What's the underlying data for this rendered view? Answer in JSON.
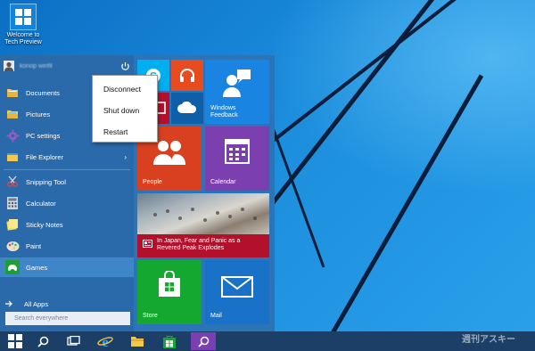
{
  "desktop": {
    "icon_label": "Welcome to Tech Preview",
    "watermark": "週刊アスキー"
  },
  "start_menu": {
    "user_name": "konop winfil",
    "left_items": [
      {
        "label": "Documents",
        "icon": "documents-folder-icon"
      },
      {
        "label": "Pictures",
        "icon": "pictures-folder-icon"
      },
      {
        "label": "PC settings",
        "icon": "gear-icon"
      },
      {
        "label": "File Explorer",
        "icon": "file-explorer-icon",
        "arrow": "›"
      },
      {
        "label": "Snipping Tool",
        "icon": "scissors-icon"
      },
      {
        "label": "Calculator",
        "icon": "calculator-icon"
      },
      {
        "label": "Sticky Notes",
        "icon": "sticky-notes-icon"
      },
      {
        "label": "Paint",
        "icon": "paint-palette-icon"
      },
      {
        "label": "Games",
        "icon": "xbox-games-icon"
      }
    ],
    "all_apps": "All Apps",
    "search_placeholder": "Search everywhere"
  },
  "power_menu": {
    "items": [
      "Disconnect",
      "Shut down",
      "Restart"
    ]
  },
  "tiles": {
    "windows_feedback": "Windows Feedback",
    "people": "People",
    "calendar": "Calendar",
    "news_headline": "In Japan, Fear and Panic as a Revered Peak Explodes",
    "store": "Store",
    "mail": "Mail"
  },
  "colors": {
    "menu_bg": "#2a6aab",
    "skype": "#00aff0",
    "music": "#e74c20",
    "onedrive": "#0f5ea8",
    "feedback": "#1a84e3",
    "people": "#d9401f",
    "calendar": "#7c3fb0",
    "news": "#b3102c",
    "store": "#14a830",
    "mail": "#1a72c8",
    "taskbar": "#1b3f66"
  }
}
